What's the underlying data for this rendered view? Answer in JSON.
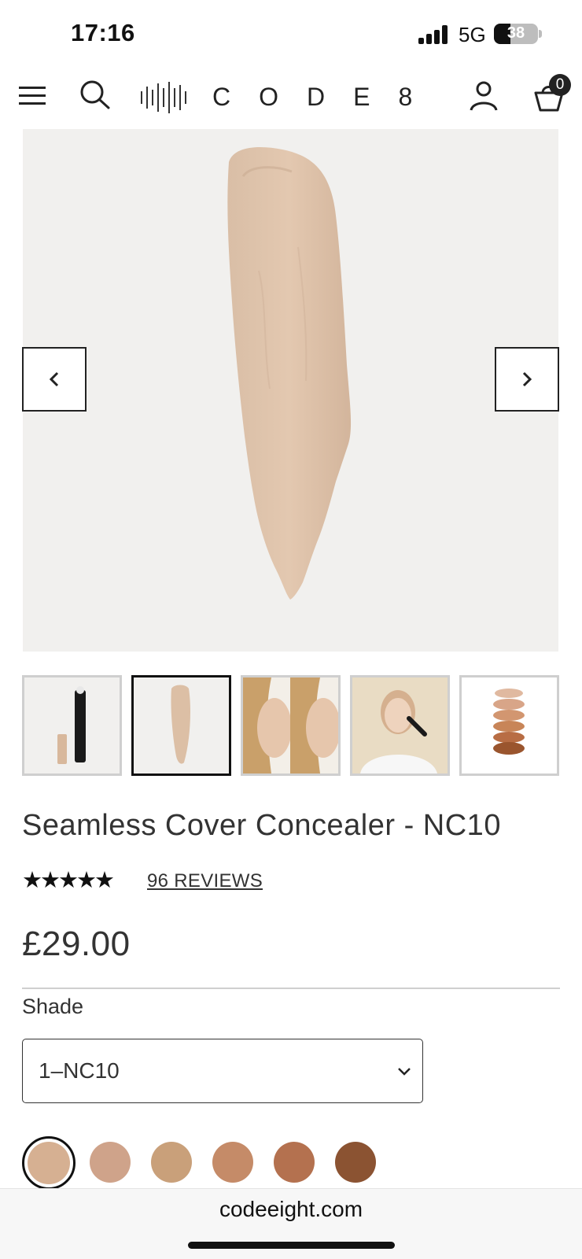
{
  "status_bar": {
    "time": "17:16",
    "network": "5G",
    "battery": "38",
    "battery_fraction": 0.38
  },
  "header": {
    "brand_wordmark": "CODE8",
    "bag_count": "0",
    "icons": [
      "menu-icon",
      "search-icon",
      "brand-logo-icon",
      "account-icon",
      "bag-icon"
    ]
  },
  "gallery": {
    "prev_icon": "chevron-left-icon",
    "next_icon": "chevron-right-icon",
    "active_index": 1,
    "thumbnails": [
      "product-bottle",
      "swatch-smear",
      "face-comparison",
      "model-applying",
      "shade-range"
    ]
  },
  "product": {
    "title": "Seamless Cover Concealer - NC10",
    "stars": "★★★★★",
    "rating": 5,
    "reviews_label": "96 REVIEWS",
    "price": "£29.00"
  },
  "shade": {
    "label": "Shade",
    "selected": "1–NC10",
    "swatches": [
      "#d6b092",
      "#cfa38a",
      "#c9a07a",
      "#c58b68",
      "#b4714f",
      "#8b5332"
    ],
    "selected_index": 0
  },
  "browser": {
    "url": "codeeight.com"
  },
  "colors": {
    "hero_bg": "#f1f0ee",
    "text": "#333333",
    "accent": "#111111"
  }
}
